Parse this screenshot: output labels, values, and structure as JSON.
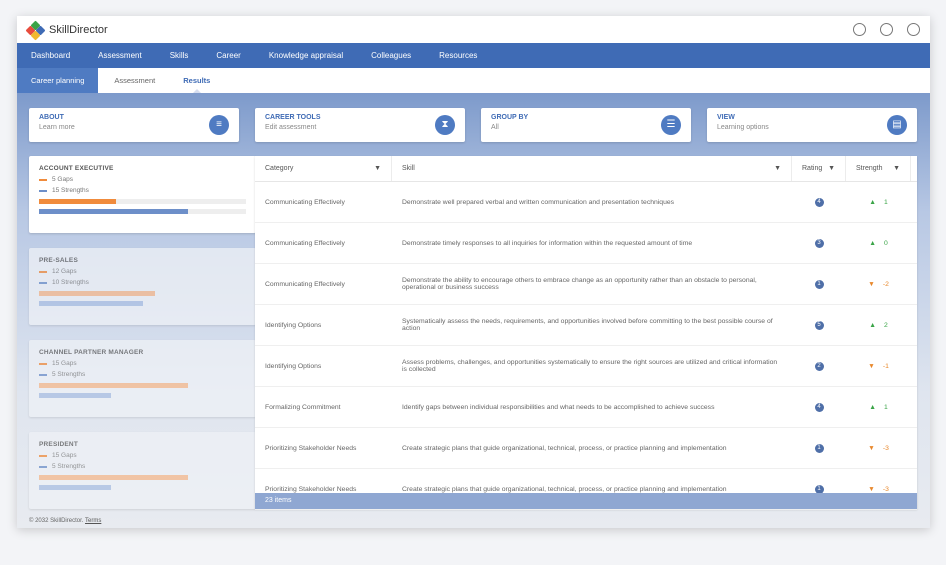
{
  "app": {
    "title": "SkillDirector"
  },
  "nav": [
    "Dashboard",
    "Assessment",
    "Skills",
    "Career",
    "Knowledge appraisal",
    "Colleagues",
    "Resources"
  ],
  "subnav": [
    "Career planning",
    "Assessment",
    "Results"
  ],
  "cards": [
    {
      "title": "ABOUT",
      "sub": "Learn more",
      "icon": "document-icon"
    },
    {
      "title": "CAREER TOOLS",
      "sub": "Edit assessment",
      "icon": "hourglass-icon"
    },
    {
      "title": "GROUP BY",
      "sub": "All",
      "icon": "list-icon"
    },
    {
      "title": "VIEW",
      "sub": "Learning options",
      "icon": "clipboard-icon"
    }
  ],
  "roles": [
    {
      "name": "ACCOUNT EXECUTIVE",
      "gaps": "5 Gaps",
      "strengths": "15 Strengths",
      "gap_level": 0.37,
      "strength_level": 0.72
    },
    {
      "name": "PRE-SALES",
      "gaps": "12 Gaps",
      "strengths": "10 Strengths",
      "gap_level": 0.56,
      "strength_level": 0.5
    },
    {
      "name": "CHANNEL PARTNER MANAGER",
      "gaps": "15 Gaps",
      "strengths": "5 Strengths",
      "gap_level": 0.72,
      "strength_level": 0.35
    },
    {
      "name": "PRESIDENT",
      "gaps": "15 Gaps",
      "strengths": "5 Strengths",
      "gap_level": 0.72,
      "strength_level": 0.35
    }
  ],
  "colors": {
    "gap": "#f08b3c",
    "strength": "#6d8fc9",
    "primary": "#3f6bb5"
  },
  "table": {
    "headers": [
      "Category",
      "Skill",
      "Rating",
      "Strength"
    ],
    "rows": [
      {
        "cat": "Communicating Effectively",
        "skill": "Demonstrate well prepared verbal and written communication and presentation techniques",
        "rating": "4",
        "dir": "up",
        "val": "1"
      },
      {
        "cat": "Communicating Effectively",
        "skill": "Demonstrate timely responses to all inquiries for information within the requested amount of time",
        "rating": "3",
        "dir": "up",
        "val": "0"
      },
      {
        "cat": "Communicating Effectively",
        "skill": "Demonstrate the ability to encourage others to embrace change as an opportunity rather than an obstacle to personal, operational or business success",
        "rating": "1",
        "dir": "down",
        "val": "-2"
      },
      {
        "cat": "Identifying Options",
        "skill": "Systematically assess the needs, requirements, and opportunities involved before committing to the best possible course of action",
        "rating": "5",
        "dir": "up",
        "val": "2"
      },
      {
        "cat": "Identifying Options",
        "skill": "Assess problems, challenges, and opportunities systematically to ensure the right sources are utilized and critical information is collected",
        "rating": "2",
        "dir": "down",
        "val": "-1"
      },
      {
        "cat": "Formalizing Commitment",
        "skill": "Identify gaps between individual responsibilities and what needs to be accomplished to achieve success",
        "rating": "4",
        "dir": "up",
        "val": "1"
      },
      {
        "cat": "Prioritizing Stakeholder Needs",
        "skill": "Create strategic plans that guide organizational, technical, process, or practice planning and implementation",
        "rating": "1",
        "dir": "down",
        "val": "-3"
      },
      {
        "cat": "Prioritizing Stakeholder Needs",
        "skill": "Create strategic plans that guide organizational, technical, process, or practice planning and implementation",
        "rating": "1",
        "dir": "down",
        "val": "-3"
      }
    ],
    "footer": "23 items"
  },
  "footer": {
    "copyright": "© 2032 SkillDirector.",
    "terms": "Terms"
  }
}
